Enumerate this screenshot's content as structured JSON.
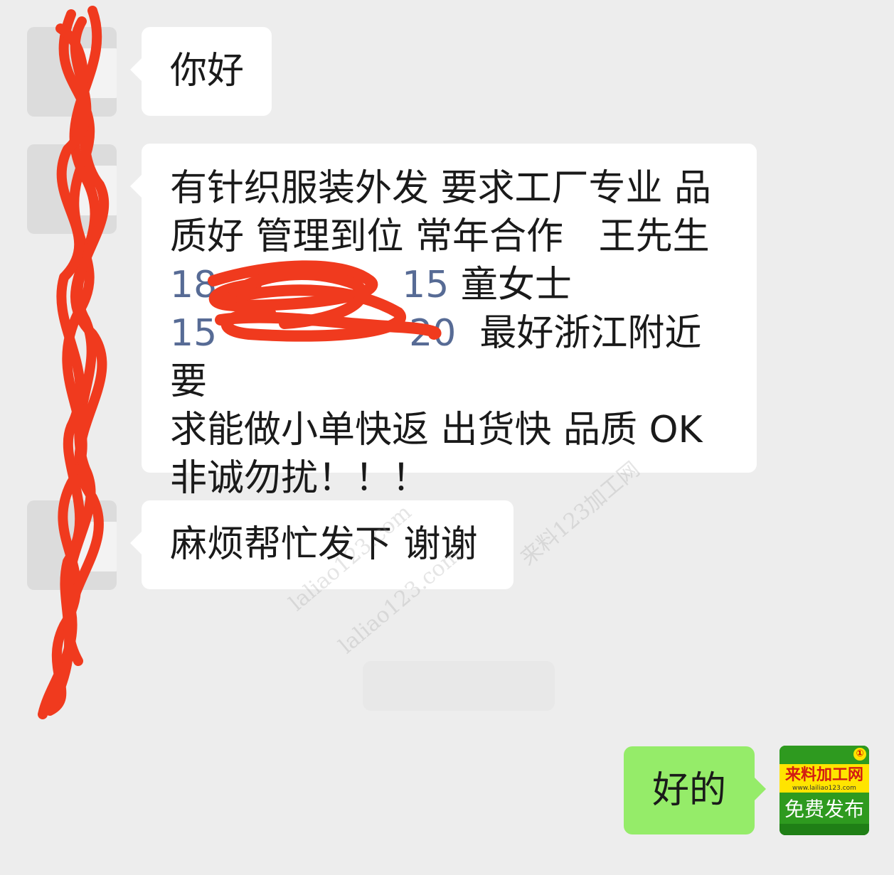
{
  "conversation": {
    "messages": [
      {
        "side": "left",
        "text": "你好"
      },
      {
        "side": "left",
        "text_line1": "有针织服装外发 要求工厂专业 品",
        "text_line2": "质好 管理到位 常年合作   王先生",
        "phone1": "18",
        "phone1_tail": "15",
        "contact2": " 童女士",
        "phone2": "15",
        "phone2_tail": "20",
        "text_line4": "  最好浙江附近 要",
        "text_line5": "求能做小单快返 出货快 品质 OK",
        "text_line6": "非诚勿扰！！！"
      },
      {
        "side": "left",
        "text": "麻烦帮忙发下 谢谢"
      },
      {
        "side": "right",
        "text": "好的"
      }
    ]
  },
  "self_avatar": {
    "logo_name": "来料加工网",
    "logo_url": "www.lailiao123.com",
    "logo_slogan": "免费发布",
    "badge": "①"
  },
  "watermarks": [
    "laliao123.com",
    "来料123加工网",
    "laliao123.com"
  ],
  "colors": {
    "background": "#ededed",
    "incoming_bubble": "#ffffff",
    "outgoing_bubble": "#95ec69",
    "phone_link": "#576b95",
    "redaction": "#f03a1e"
  },
  "icons": [
    "avatar",
    "brand-logo"
  ]
}
